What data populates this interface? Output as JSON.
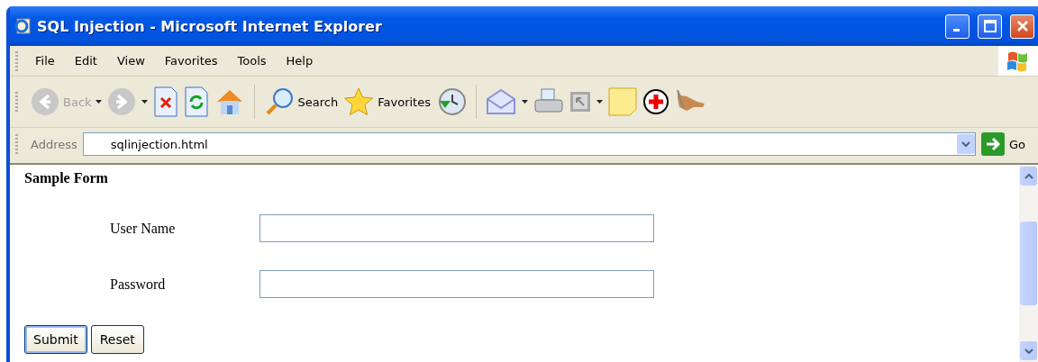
{
  "window": {
    "title": "SQL Injection - Microsoft Internet Explorer"
  },
  "menu": [
    "File",
    "Edit",
    "View",
    "Favorites",
    "Tools",
    "Help"
  ],
  "toolbar": {
    "back": {
      "label": "Back",
      "disabled": true
    },
    "search": {
      "label": "Search"
    },
    "favorites": {
      "label": "Favorites"
    }
  },
  "address": {
    "label": "Address",
    "value": "sqlinjection.html",
    "go": "Go"
  },
  "page": {
    "heading": "Sample Form",
    "fields": [
      {
        "label": "User Name"
      },
      {
        "label": "Password"
      }
    ],
    "buttons": [
      "Submit",
      "Reset"
    ]
  }
}
